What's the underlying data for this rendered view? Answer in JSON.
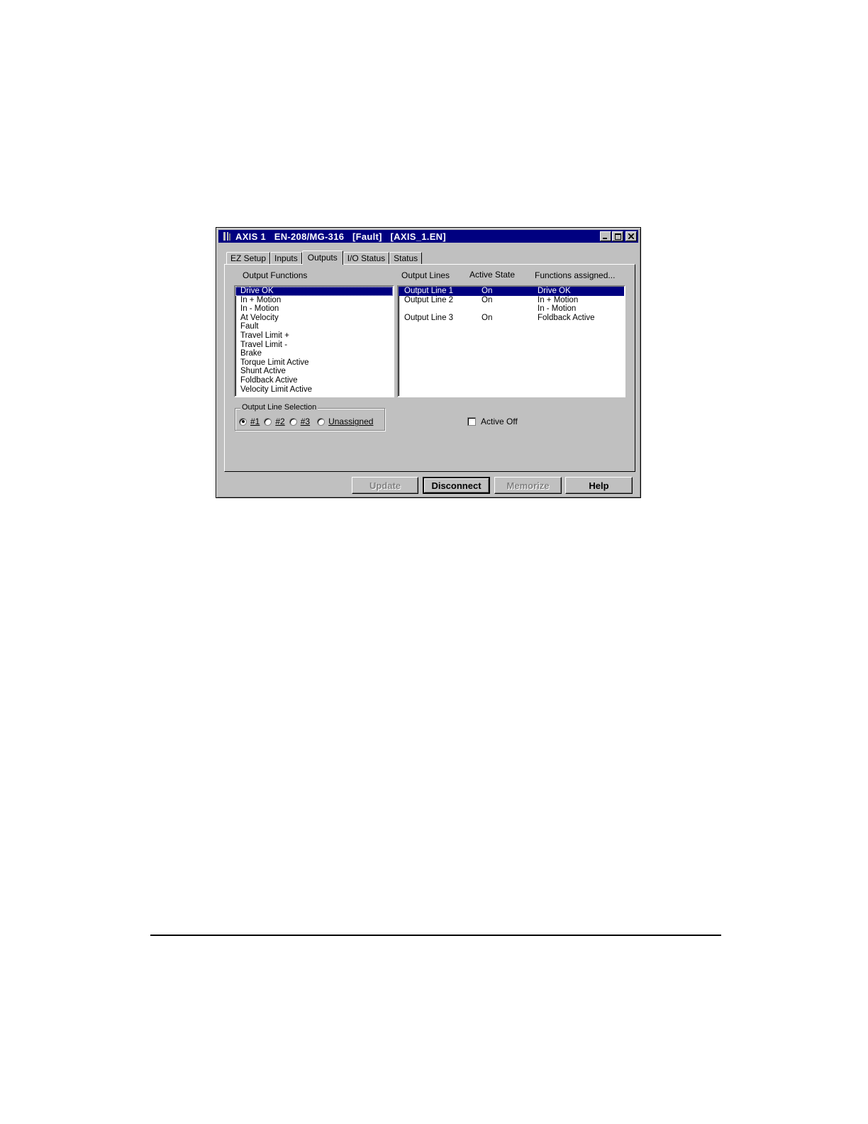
{
  "window": {
    "title": "AXIS 1   EN-208/MG-316   [Fault]   [AXIS_1.EN]",
    "controls": {
      "minimize": "_",
      "maximize": "□",
      "close": "✕"
    }
  },
  "tabs": [
    {
      "label": "EZ Setup",
      "active": false
    },
    {
      "label": "Inputs",
      "active": false
    },
    {
      "label": "Outputs",
      "active": true
    },
    {
      "label": "I/O Status",
      "active": false
    },
    {
      "label": "Status",
      "active": false
    }
  ],
  "output_functions": {
    "header": "Output Functions",
    "items": [
      "Drive OK",
      "In + Motion",
      "In - Motion",
      "At Velocity",
      "Fault",
      "Travel Limit +",
      "Travel Limit -",
      "Brake",
      "Torque Limit Active",
      "Shunt Active",
      "Foldback Active",
      "Velocity Limit Active"
    ],
    "selected_index": 0
  },
  "output_lines": {
    "headers": {
      "line": "Output Lines",
      "state": "Active State",
      "functions": "Functions assigned..."
    },
    "rows": [
      {
        "line": "Output Line 1",
        "state": "On",
        "function": "Drive OK",
        "selected": true
      },
      {
        "line": "Output Line 2",
        "state": "On",
        "function": "In + Motion",
        "selected": false
      },
      {
        "line": "",
        "state": "",
        "function": "In - Motion",
        "selected": false
      },
      {
        "line": "Output Line 3",
        "state": "On",
        "function": "Foldback Active",
        "selected": false
      }
    ]
  },
  "output_line_selection": {
    "legend": "Output Line Selection",
    "options": [
      "#1",
      "#2",
      "#3",
      "Unassigned"
    ],
    "selected": "#1"
  },
  "active_off": {
    "label": "Active Off",
    "checked": false
  },
  "buttons": {
    "update": "Update",
    "disconnect": "Disconnect",
    "memorize": "Memorize",
    "help": "Help"
  }
}
